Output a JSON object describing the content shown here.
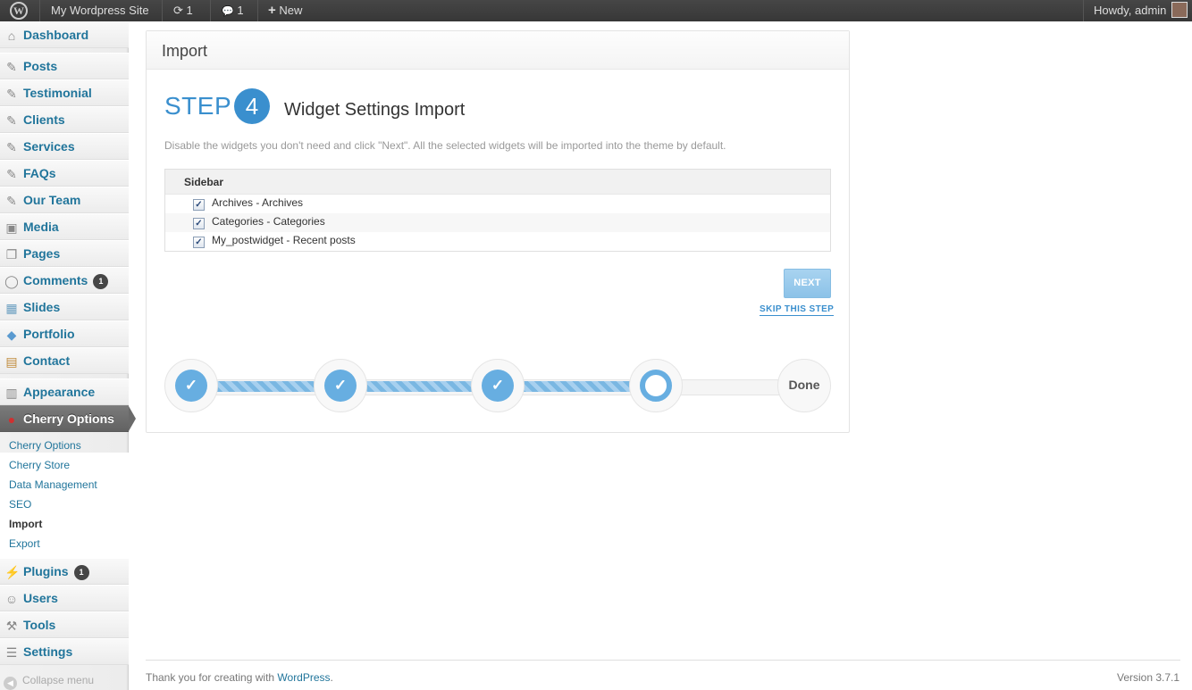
{
  "adminbar": {
    "site_name": "My Wordpress Site",
    "updates_count": "1",
    "comments_count": "1",
    "new_label": "New",
    "howdy": "Howdy, admin",
    "wp_logo_glyph": "W",
    "update_glyph": "⟳",
    "comment_glyph": "💬",
    "new_glyph": "+"
  },
  "sidebar": {
    "items": [
      {
        "label": "Dashboard",
        "icon": "⌂"
      },
      {
        "label": "Posts",
        "icon": "✎"
      },
      {
        "label": "Testimonial",
        "icon": "✎"
      },
      {
        "label": "Clients",
        "icon": "✎"
      },
      {
        "label": "Services",
        "icon": "✎"
      },
      {
        "label": "FAQs",
        "icon": "✎"
      },
      {
        "label": "Our Team",
        "icon": "✎"
      },
      {
        "label": "Media",
        "icon": "▣"
      },
      {
        "label": "Pages",
        "icon": "❐"
      },
      {
        "label": "Comments",
        "icon": "◯",
        "badge": "1"
      },
      {
        "label": "Slides",
        "icon": "▦"
      },
      {
        "label": "Portfolio",
        "icon": "◆"
      },
      {
        "label": "Contact",
        "icon": "▤"
      },
      {
        "label": "Appearance",
        "icon": "▥"
      },
      {
        "label": "Cherry Options",
        "icon": "●"
      },
      {
        "label": "Plugins",
        "icon": "⚡",
        "badge": "1"
      },
      {
        "label": "Users",
        "icon": "☺"
      },
      {
        "label": "Tools",
        "icon": "⚒"
      },
      {
        "label": "Settings",
        "icon": "☰"
      }
    ],
    "submenu": [
      "Cherry Options",
      "Cherry Store",
      "Data Management",
      "SEO",
      "Import",
      "Export"
    ],
    "collapse_label": "Collapse menu",
    "collapse_glyph": "◀"
  },
  "panel": {
    "title": "Import",
    "step_word": "STEP",
    "step_number": "4",
    "step_title": "Widget Settings Import",
    "description": "Disable the widgets you don't need and click \"Next\". All the selected widgets will be imported into the theme by default.",
    "widget_group": "Sidebar",
    "widgets": [
      {
        "label": "Archives - Archives",
        "checked": true
      },
      {
        "label": "Categories - Categories",
        "checked": true
      },
      {
        "label": "My_postwidget - Recent posts",
        "checked": true
      }
    ],
    "next_label": "NEXT",
    "skip_label": "SKIP THIS STEP",
    "done_label": "Done",
    "check_glyph": "✓",
    "progress_step": 4,
    "progress_total": 5
  },
  "footer": {
    "thanks_prefix": "Thank you for creating with ",
    "wordpress_link": "WordPress",
    "thanks_suffix": ".",
    "version": "Version 3.7.1"
  },
  "colors": {
    "accent": "#3a8fce",
    "link": "#21759b",
    "adminbar": "#464646"
  }
}
